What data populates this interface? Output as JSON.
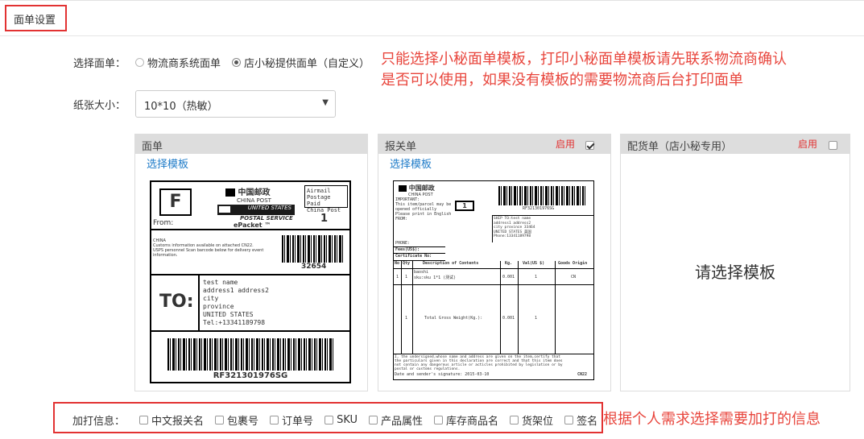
{
  "page_title": "面单设置",
  "waybill": {
    "label": "选择面单：",
    "options": [
      {
        "text": "物流商系统面单",
        "selected": false
      },
      {
        "text": "店小秘提供面单（自定义）",
        "selected": true
      }
    ]
  },
  "paper_size": {
    "label": "纸张大小：",
    "value": "10*10（热敏）"
  },
  "notes": {
    "template_tip_line1": "只能选择小秘面单模板，打印小秘面单模板请先联系物流商确认",
    "template_tip_line2": "是否可以使用，如果没有模板的需要物流商后台打印面单",
    "extras_tip": "根据个人需求选择需要加打的信息"
  },
  "panels": {
    "waybill": {
      "title": "面单",
      "link": "选择模板"
    },
    "customs": {
      "title": "报关单",
      "enable_label": "启用",
      "enabled": true,
      "link": "选择模板"
    },
    "picking": {
      "title": "配货单（店小秘专用）",
      "enable_label": "启用",
      "enabled": false,
      "placeholder": "请选择模板"
    }
  },
  "waybill_preview": {
    "mark": "F",
    "from_label": "From:",
    "brand_cn": "中国邮政",
    "brand_en": "CHINA POST",
    "usps_line1": "UNITED STATES",
    "usps_line2": "POSTAL SERVICE",
    "epacket": "ePacket ™",
    "airmail_line1": "Airmail",
    "airmail_line2": "Postage Paid",
    "airmail_line3": "China Post",
    "count": "1",
    "origin_country": "CHINA",
    "customs_note_line1": "Customs information available on attached CN22.",
    "customs_note_line2": "USPS personnel Scan barcode below for delivery event",
    "customs_note_line3": "information.",
    "zip": "32654",
    "to_label": "TO:",
    "address_lines": [
      "test name",
      "address1 address2",
      "city",
      "province",
      "UNITED STATES",
      "Tel:+13341189798"
    ],
    "tracking": "RF321301976SG"
  },
  "customs_preview": {
    "brand_cn": "中国邮政",
    "brand_en": "CHINA POST",
    "important": "IMPORTANT:",
    "important_lines": [
      "This item/parcel may be",
      "opened officially",
      "Please print in English"
    ],
    "from": "FROM:",
    "count": "1",
    "tracking": "RF321301976SG",
    "ship_to_lines": [
      "SHIP TO:test name",
      "address1 address2",
      "city province 33464",
      "UNITED STATES 美国",
      "Phone:13341189798"
    ],
    "phone": "PHONE:",
    "fees": "Fees(US$):",
    "certificate": "Certificate No:",
    "headers": [
      "No",
      "Qty",
      "Description of Contents",
      "Kg.",
      "Val(US $)",
      "Goods Origin"
    ],
    "row1": [
      "1",
      "1",
      "baoshi",
      "sku:sku 1*1 (测试)",
      "0.001",
      "1",
      "CN"
    ],
    "total_row": [
      "1",
      "Total Gross Weight(Kg.):",
      "0.001",
      "1"
    ],
    "declaration_lines": [
      "I, the undersigned,whose name and address are given on the item,certify that",
      "the particulars given in this declaration are correct and that this item does",
      "not contain any dangerous article or acticles prohibited by legislation or by",
      "postal or customs regulations."
    ],
    "date_line": "Date and sender's signature: 2015-03-10",
    "form_code": "CN22"
  },
  "extras": {
    "label": "加打信息：",
    "options": [
      "中文报关名",
      "包裹号",
      "订单号",
      "SKU",
      "产品属性",
      "库存商品名",
      "货架位",
      "签名"
    ]
  }
}
